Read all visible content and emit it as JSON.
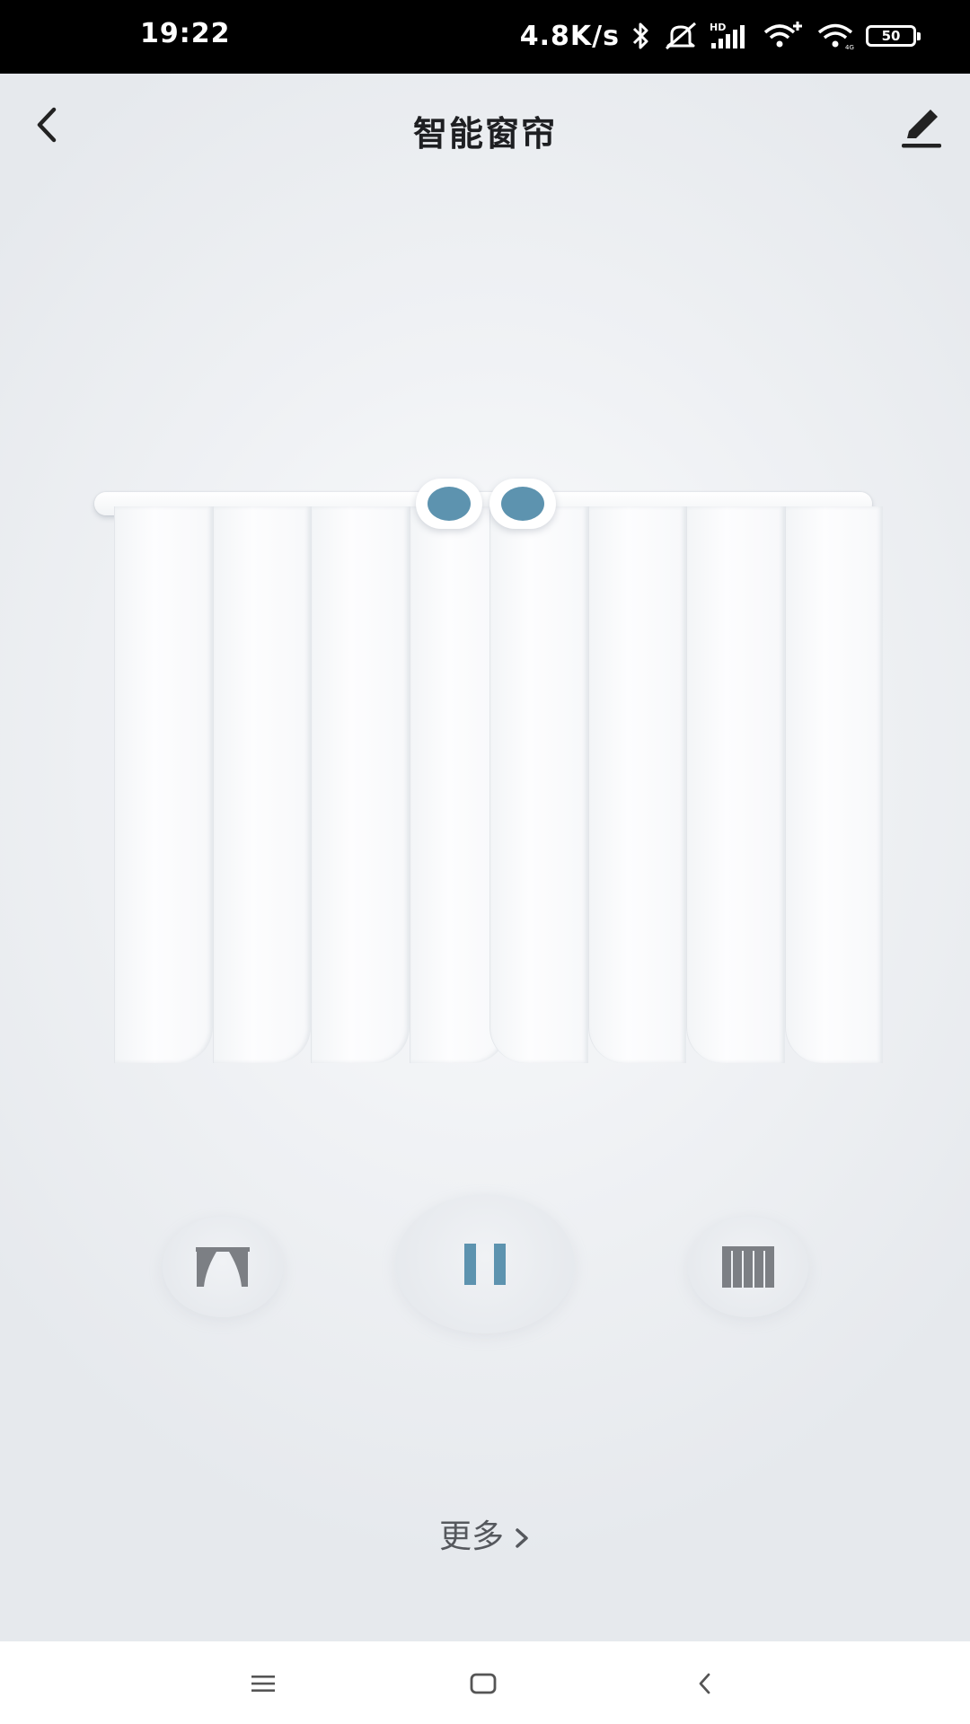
{
  "status_bar": {
    "time": "19:22",
    "net_speed": "4.8K/s",
    "battery_level": "50",
    "icons": [
      "bluetooth-icon",
      "mute-icon",
      "hd-signal-icon",
      "wifi-plus-icon",
      "wifi-icon",
      "battery-icon"
    ]
  },
  "header": {
    "title": "智能窗帘",
    "back_icon": "chevron-left-icon",
    "edit_icon": "pencil-icon"
  },
  "curtain": {
    "state": "closed",
    "accent_color": "#5d93af"
  },
  "controls": {
    "icons": [
      "curtain-open-icon",
      "pause-icon",
      "curtain-close-icon"
    ],
    "accent_color": "#5d93af"
  },
  "more": {
    "label": "更多"
  },
  "nav_bar": {
    "icons": [
      "menu-icon",
      "home-icon",
      "back-icon"
    ]
  }
}
